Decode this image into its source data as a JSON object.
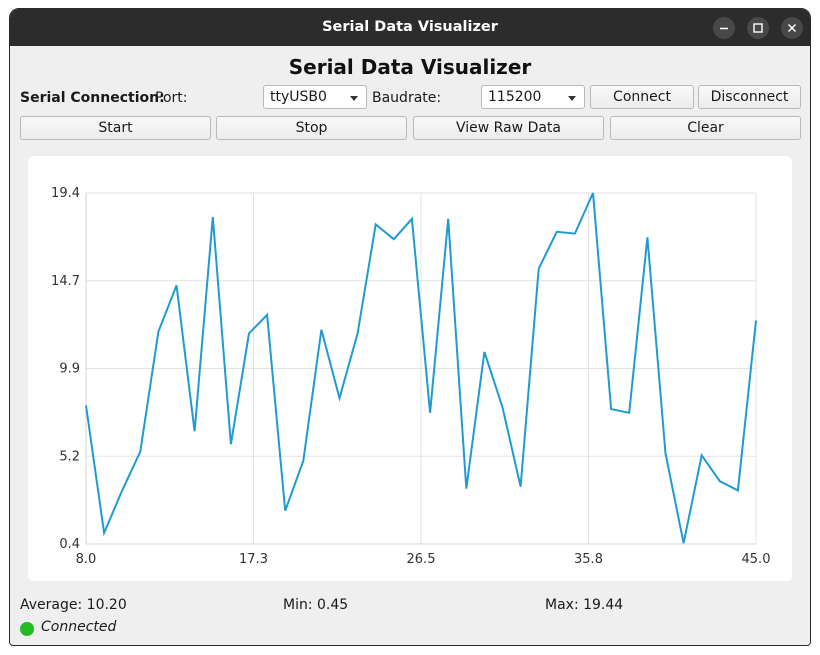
{
  "window": {
    "title": "Serial Data Visualizer"
  },
  "app": {
    "heading": "Serial Data Visualizer"
  },
  "connection": {
    "section_label": "Serial Connection:",
    "port_label": "Port:",
    "port_value": "ttyUSB0",
    "baud_label": "Baudrate:",
    "baud_value": "115200",
    "connect_label": "Connect",
    "disconnect_label": "Disconnect"
  },
  "controls": {
    "start_label": "Start",
    "stop_label": "Stop",
    "raw_label": "View Raw Data",
    "clear_label": "Clear"
  },
  "chart_data": {
    "type": "line",
    "title": "",
    "xlabel": "",
    "ylabel": "",
    "xlim": [
      8.0,
      45.0
    ],
    "ylim": [
      0.4,
      19.4
    ],
    "x_ticks": [
      "8.0",
      "17.3",
      "26.5",
      "35.8",
      "45.0"
    ],
    "y_ticks": [
      "19.4",
      "14.7",
      "9.9",
      "5.2",
      "0.4"
    ],
    "grid": true,
    "color": "#1f9bd1",
    "series": [
      {
        "x": [
          8,
          9,
          10,
          11,
          12,
          13,
          14,
          15,
          16,
          17,
          18,
          19,
          20,
          21,
          22,
          23,
          24,
          25,
          26,
          27,
          28,
          29,
          30,
          31,
          32,
          33,
          34,
          35,
          36,
          37,
          38,
          39,
          40,
          41,
          42,
          43,
          44,
          45
        ],
        "values": [
          7.9,
          1.0,
          3.3,
          5.4,
          11.9,
          14.4,
          6.5,
          18.1,
          5.8,
          11.8,
          12.8,
          2.2,
          4.9,
          12.0,
          8.3,
          11.8,
          17.7,
          16.9,
          18.0,
          7.5,
          18.0,
          3.4,
          10.8,
          7.8,
          3.5,
          15.3,
          17.3,
          17.2,
          19.4,
          7.7,
          7.5,
          17.0,
          5.3,
          0.45,
          5.2,
          3.8,
          3.3,
          12.5
        ]
      }
    ]
  },
  "stats": {
    "average": "Average: 10.20",
    "min": "Min: 0.45",
    "max": "Max: 19.44"
  },
  "status": {
    "text": "Connected",
    "color": "#22bb22"
  }
}
